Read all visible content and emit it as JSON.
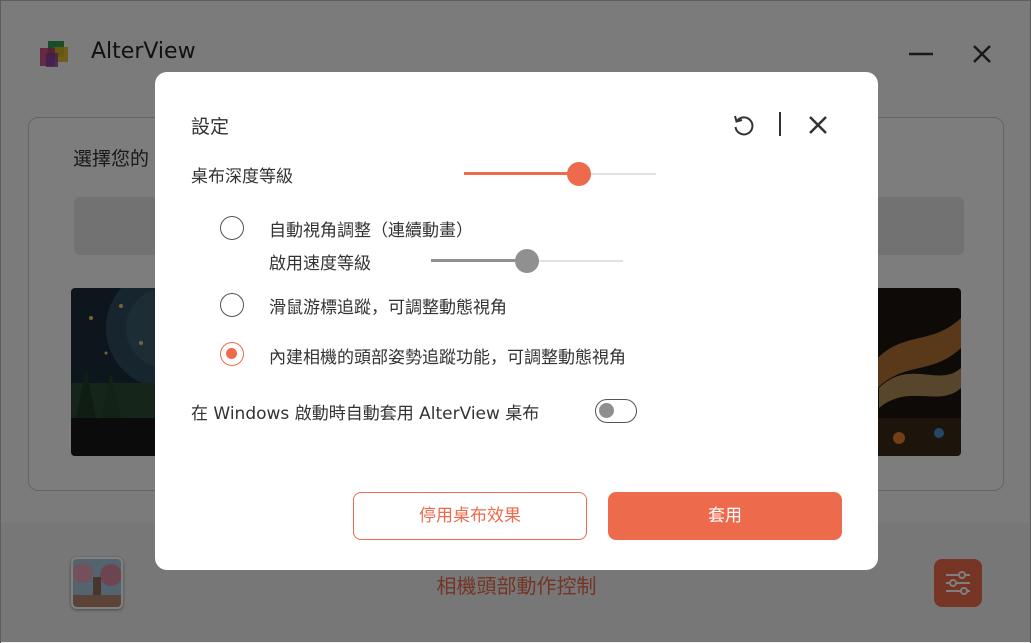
{
  "app": {
    "title": "AlterView",
    "panel_label": "選擇您的",
    "bottom_label": "相機頭部動作控制",
    "logo_icon": "alterview-logo-icon",
    "accent_color": "#ee6a4c"
  },
  "dialog": {
    "title": "設定",
    "depth_label": "桌布深度等級",
    "depth_level": 0.6,
    "options": [
      {
        "label": "自動視角調整（連續動畫）",
        "checked": false
      },
      {
        "label": "滑鼠游標追蹤，可調整動態視角",
        "checked": false
      },
      {
        "label": "內建相機的頭部姿勢追蹤功能，可調整動態視角",
        "checked": true
      }
    ],
    "speed_label": "啟用速度等級",
    "speed_level": 0.5,
    "startup_label": "在 Windows 啟動時自動套用 AlterView 桌布",
    "startup_enabled": false,
    "disable_button": "停用桌布效果",
    "apply_button": "套用"
  }
}
